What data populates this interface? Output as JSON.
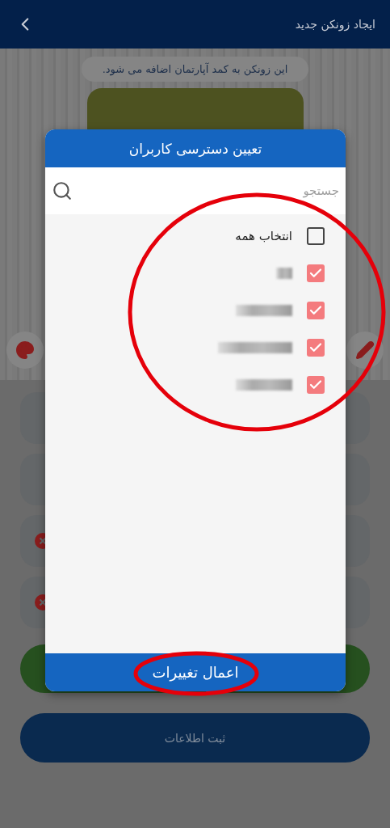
{
  "header": {
    "title": "ایجاد زونکن جدید"
  },
  "toast": {
    "text": "این زونکن به کمد آپارتمان اضافه می شود."
  },
  "background_fields": [
    {
      "kind": "plain"
    },
    {
      "kind": "plain"
    },
    {
      "kind": "error"
    },
    {
      "kind": "error"
    }
  ],
  "submit_button": {
    "label": "ثبت اطلاعات"
  },
  "dialog": {
    "title": "تعیین دسترسی کاربران",
    "search": {
      "placeholder": "جستجو"
    },
    "select_all": {
      "label": "انتخاب همه",
      "checked": false
    },
    "members": [
      {
        "checked": true
      },
      {
        "checked": true
      },
      {
        "checked": true
      },
      {
        "checked": true
      }
    ],
    "apply_button": {
      "label": "اعمال تغییرات"
    }
  },
  "annotations": [
    {
      "kind": "circle"
    },
    {
      "kind": "oval"
    }
  ]
}
